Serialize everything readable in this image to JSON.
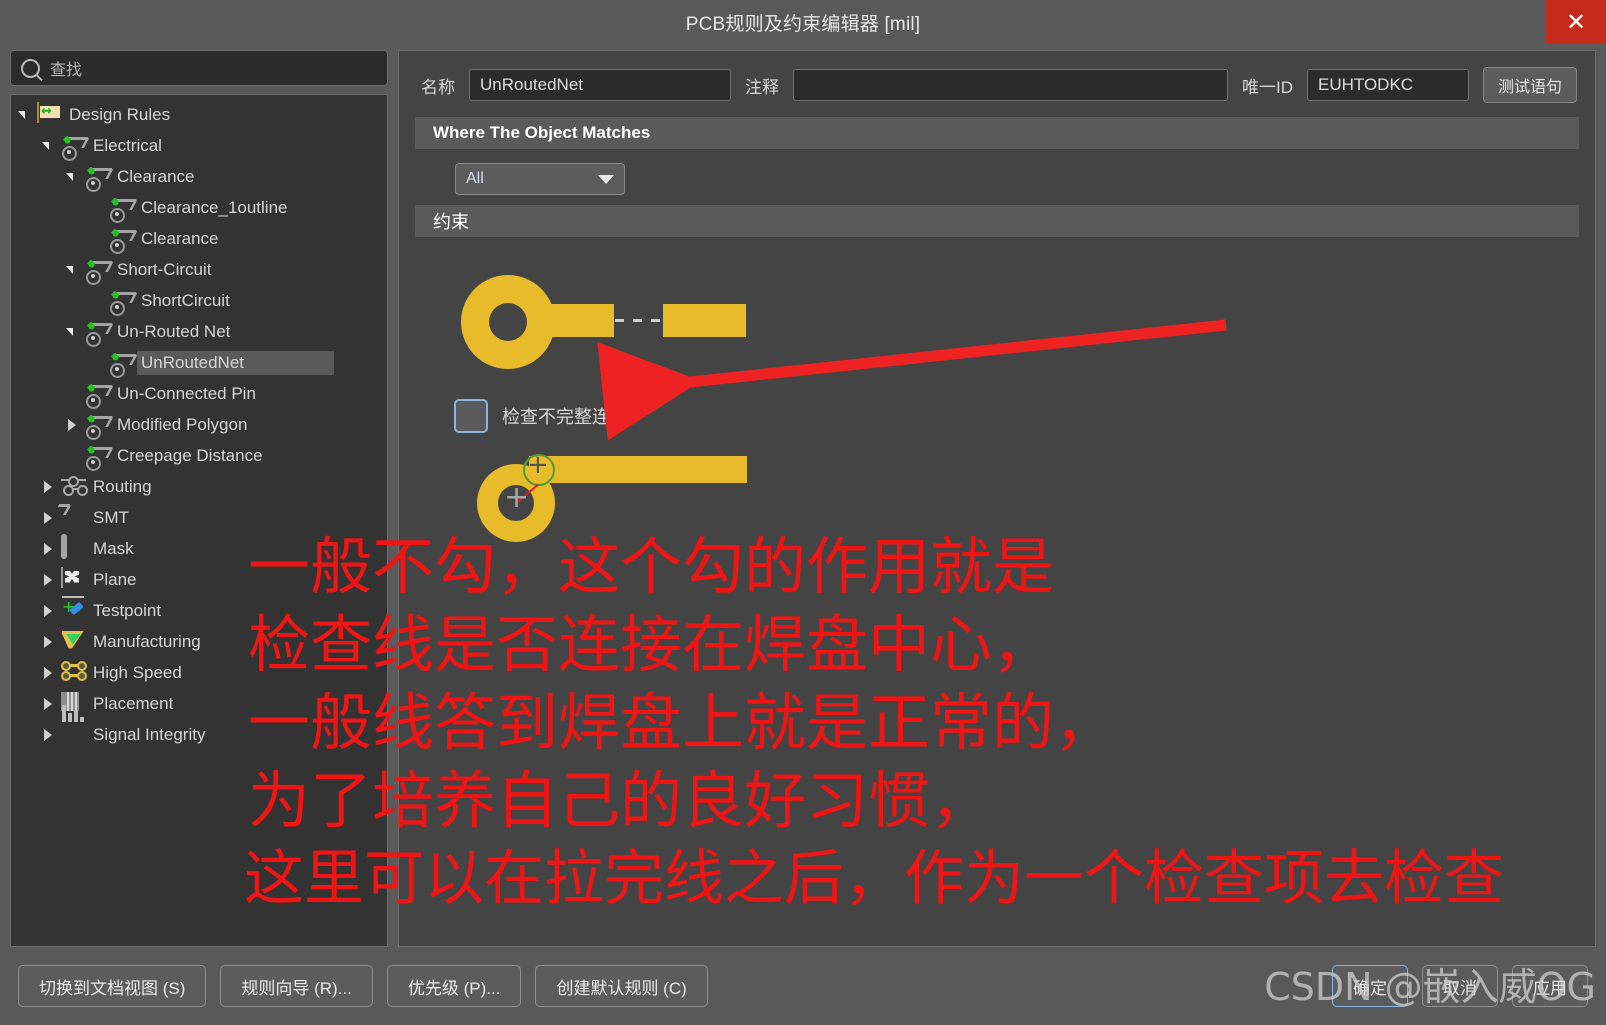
{
  "window": {
    "title": "PCB规则及约束编辑器 [mil]",
    "close_label": "✕"
  },
  "search": {
    "placeholder": "查找",
    "icon": "search-icon"
  },
  "tree": {
    "items": [
      {
        "label": "Design Rules",
        "depth": 0,
        "arrow": "down",
        "icon": "folder-icon",
        "selected": false
      },
      {
        "label": "Electrical",
        "depth": 1,
        "arrow": "down",
        "icon": "rule-icon",
        "selected": false
      },
      {
        "label": "Clearance",
        "depth": 2,
        "arrow": "down",
        "icon": "rule-icon",
        "selected": false
      },
      {
        "label": "Clearance_1outline",
        "depth": 3,
        "arrow": "none",
        "icon": "rule-icon",
        "selected": false
      },
      {
        "label": "Clearance",
        "depth": 3,
        "arrow": "none",
        "icon": "rule-icon",
        "selected": false
      },
      {
        "label": "Short-Circuit",
        "depth": 2,
        "arrow": "down",
        "icon": "rule-icon",
        "selected": false
      },
      {
        "label": "ShortCircuit",
        "depth": 3,
        "arrow": "none",
        "icon": "rule-icon",
        "selected": false
      },
      {
        "label": "Un-Routed Net",
        "depth": 2,
        "arrow": "down",
        "icon": "rule-icon",
        "selected": false
      },
      {
        "label": "UnRoutedNet",
        "depth": 3,
        "arrow": "none",
        "icon": "rule-icon",
        "selected": true
      },
      {
        "label": "Un-Connected Pin",
        "depth": 2,
        "arrow": "none",
        "icon": "rule-icon",
        "selected": false
      },
      {
        "label": "Modified Polygon",
        "depth": 2,
        "arrow": "right",
        "icon": "rule-icon",
        "selected": false
      },
      {
        "label": "Creepage Distance",
        "depth": 2,
        "arrow": "none",
        "icon": "rule-icon",
        "selected": false
      },
      {
        "label": "Routing",
        "depth": 1,
        "arrow": "right",
        "icon": "routing-icon",
        "selected": false
      },
      {
        "label": "SMT",
        "depth": 1,
        "arrow": "right",
        "icon": "smt-icon",
        "selected": false
      },
      {
        "label": "Mask",
        "depth": 1,
        "arrow": "right",
        "icon": "mask-icon",
        "selected": false
      },
      {
        "label": "Plane",
        "depth": 1,
        "arrow": "right",
        "icon": "plane-icon",
        "selected": false
      },
      {
        "label": "Testpoint",
        "depth": 1,
        "arrow": "right",
        "icon": "testpoint-icon",
        "selected": false
      },
      {
        "label": "Manufacturing",
        "depth": 1,
        "arrow": "right",
        "icon": "manufacturing-icon",
        "selected": false
      },
      {
        "label": "High Speed",
        "depth": 1,
        "arrow": "right",
        "icon": "highspeed-icon",
        "selected": false
      },
      {
        "label": "Placement",
        "depth": 1,
        "arrow": "right",
        "icon": "placement-icon",
        "selected": false
      },
      {
        "label": "Signal Integrity",
        "depth": 1,
        "arrow": "right",
        "icon": "signalintegrity-icon",
        "selected": false
      }
    ]
  },
  "properties": {
    "name_label": "名称",
    "name_value": "UnRoutedNet",
    "comment_label": "注释",
    "comment_value": "",
    "comment_placeholder": "",
    "unique_id_label": "唯一ID",
    "unique_id_value": "EUHTODKC",
    "test_query_button": "测试语句"
  },
  "match_section": {
    "header": "Where The Object Matches",
    "scope_value": "All"
  },
  "constraints_section": {
    "header": "约束",
    "checkbox_label": "检查不完整连接",
    "checkbox_checked": false
  },
  "annotation": {
    "lines": [
      "一般不勾，这个勾的作用就是",
      "检查线是否连接在焊盘中心，",
      "一般线答到焊盘上就是正常的，",
      "为了培养自己的良好习惯，",
      "这里可以在拉完线之后，作为一个检查项去检查"
    ],
    "color": "#f01414"
  },
  "footer": {
    "left_buttons": [
      "切换到文档视图 (S)",
      "规则向导 (R)...",
      "优先级 (P)...",
      "创建默认规则 (C)"
    ],
    "ok": "确定",
    "cancel": "取消",
    "apply": "应用"
  },
  "watermark": "CSDN @嵌入威OG",
  "colors": {
    "pad_gold": "#e8bb2a",
    "accent_red": "#f01414",
    "close_red": "#c42b1c",
    "panel_bg": "#444444",
    "window_bg": "#595959",
    "tree_bg": "#333333",
    "focus_blue": "#8ab4dd"
  }
}
